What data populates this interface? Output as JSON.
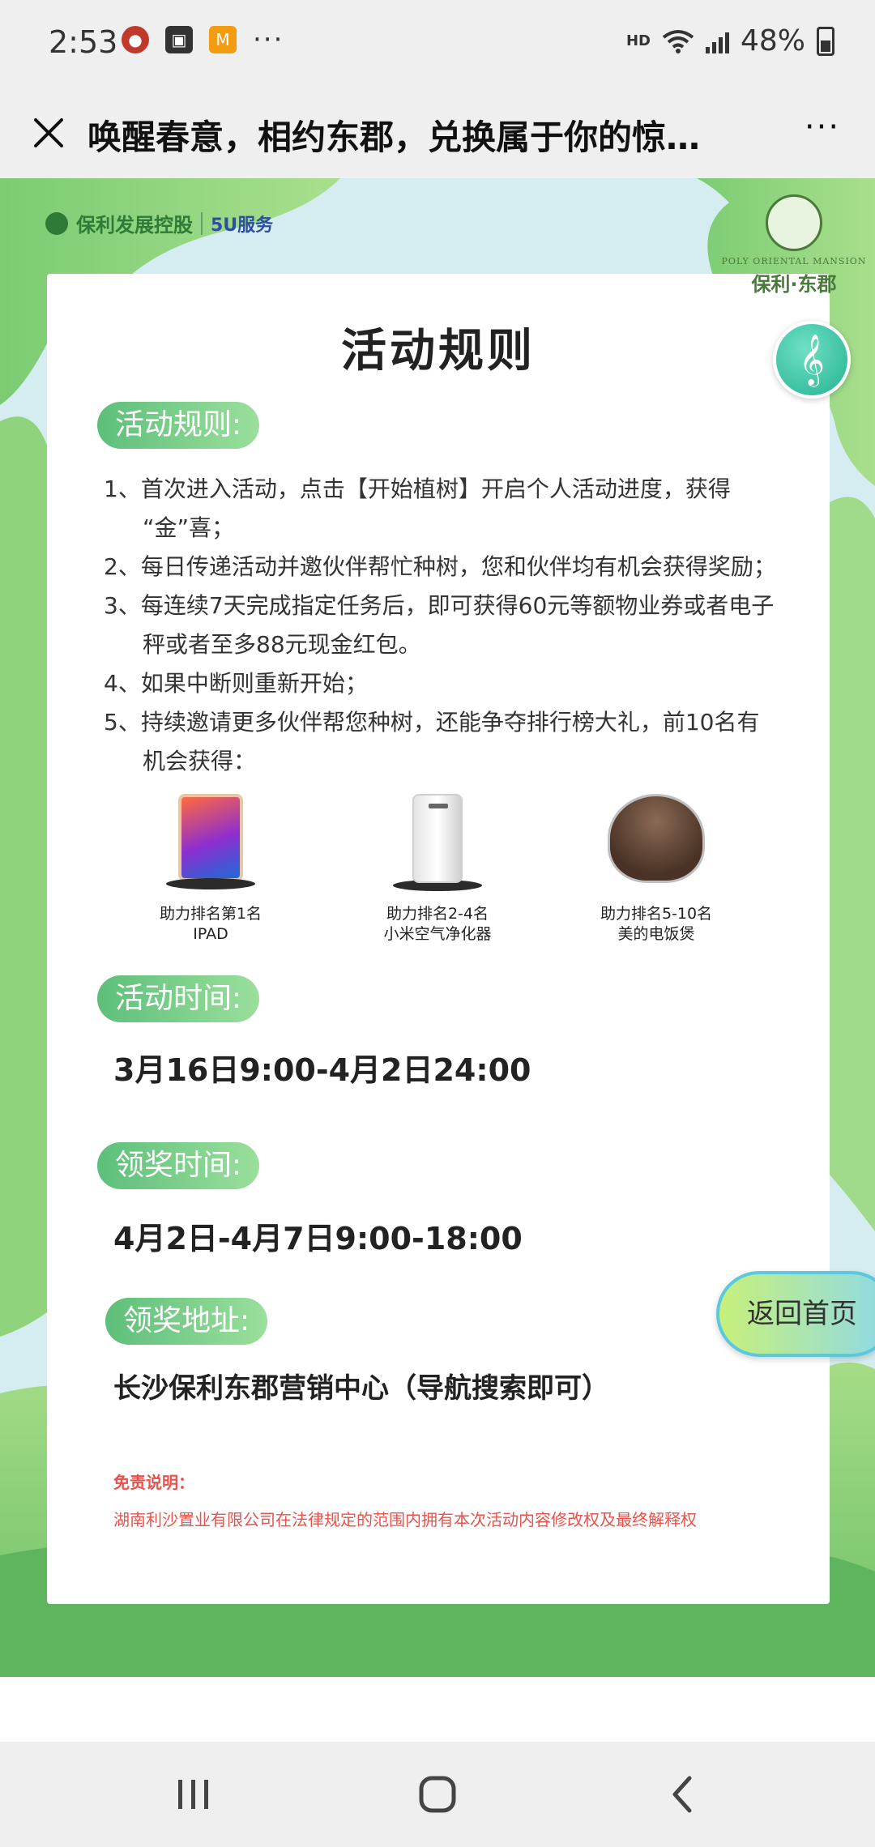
{
  "status_bar": {
    "time": "2:53",
    "left_icons": [
      "gecko-app-icon",
      "gallery-icon",
      "mango-tv-icon"
    ],
    "more": "···",
    "network_badge": "HD",
    "battery_percent": "48%"
  },
  "title_bar": {
    "title": "唤醒春意，相约东郡，兑换属于你的惊…",
    "more_label": "···"
  },
  "brand": {
    "left_name": "保利发展控股",
    "left_service": "5U服务",
    "right_en": "POLY ORIENTAL MANSION",
    "right_cn": "保利·东郡"
  },
  "music_symbol": "𝄞",
  "page_title": "活动规则",
  "sections": {
    "rules_label": "活动规则:",
    "time_label": "活动时间:",
    "award_time_label": "领奖时间:",
    "address_label": "领奖地址:"
  },
  "rules": {
    "r1": "1、首次进入活动，点击【开始植树】开启个人活动进度，获得",
    "r1_cont": "“金”喜；",
    "r2": "2、每日传递活动并邀伙伴帮忙种树，您和伙伴均有机会获得奖励；",
    "r3": "3、每连续7天完成指定任务后，即可获得60元等额物业券或者电子",
    "r3_cont": "秤或者至多88元现金红包。",
    "r4": "4、如果中断则重新开始；",
    "r5": "5、持续邀请更多伙伴帮您种树，还能争夺排行榜大礼，前10名有",
    "r5_cont": "机会获得："
  },
  "prizes": [
    {
      "rank": "助力排名第1名",
      "item": "IPAD"
    },
    {
      "rank": "助力排名2-4名",
      "item": "小米空气净化器"
    },
    {
      "rank": "助力排名5-10名",
      "item": "美的电饭煲"
    }
  ],
  "activity_time": "3月16日9:00-4月2日24:00",
  "award_time": "4月2日-4月7日9:00-18:00",
  "award_address": "长沙保利东郡营销中心（导航搜索即可）",
  "disclaimer": {
    "title": "免责说明：",
    "text": "湖南利沙置业有限公司在法律规定的范围内拥有本次活动内容修改权及最终解释权"
  },
  "home_button": "返回首页",
  "colors": {
    "accent_green": "#5dbf7a",
    "background_teal": "#d5edf0",
    "disclaimer_red": "#e8524c"
  }
}
